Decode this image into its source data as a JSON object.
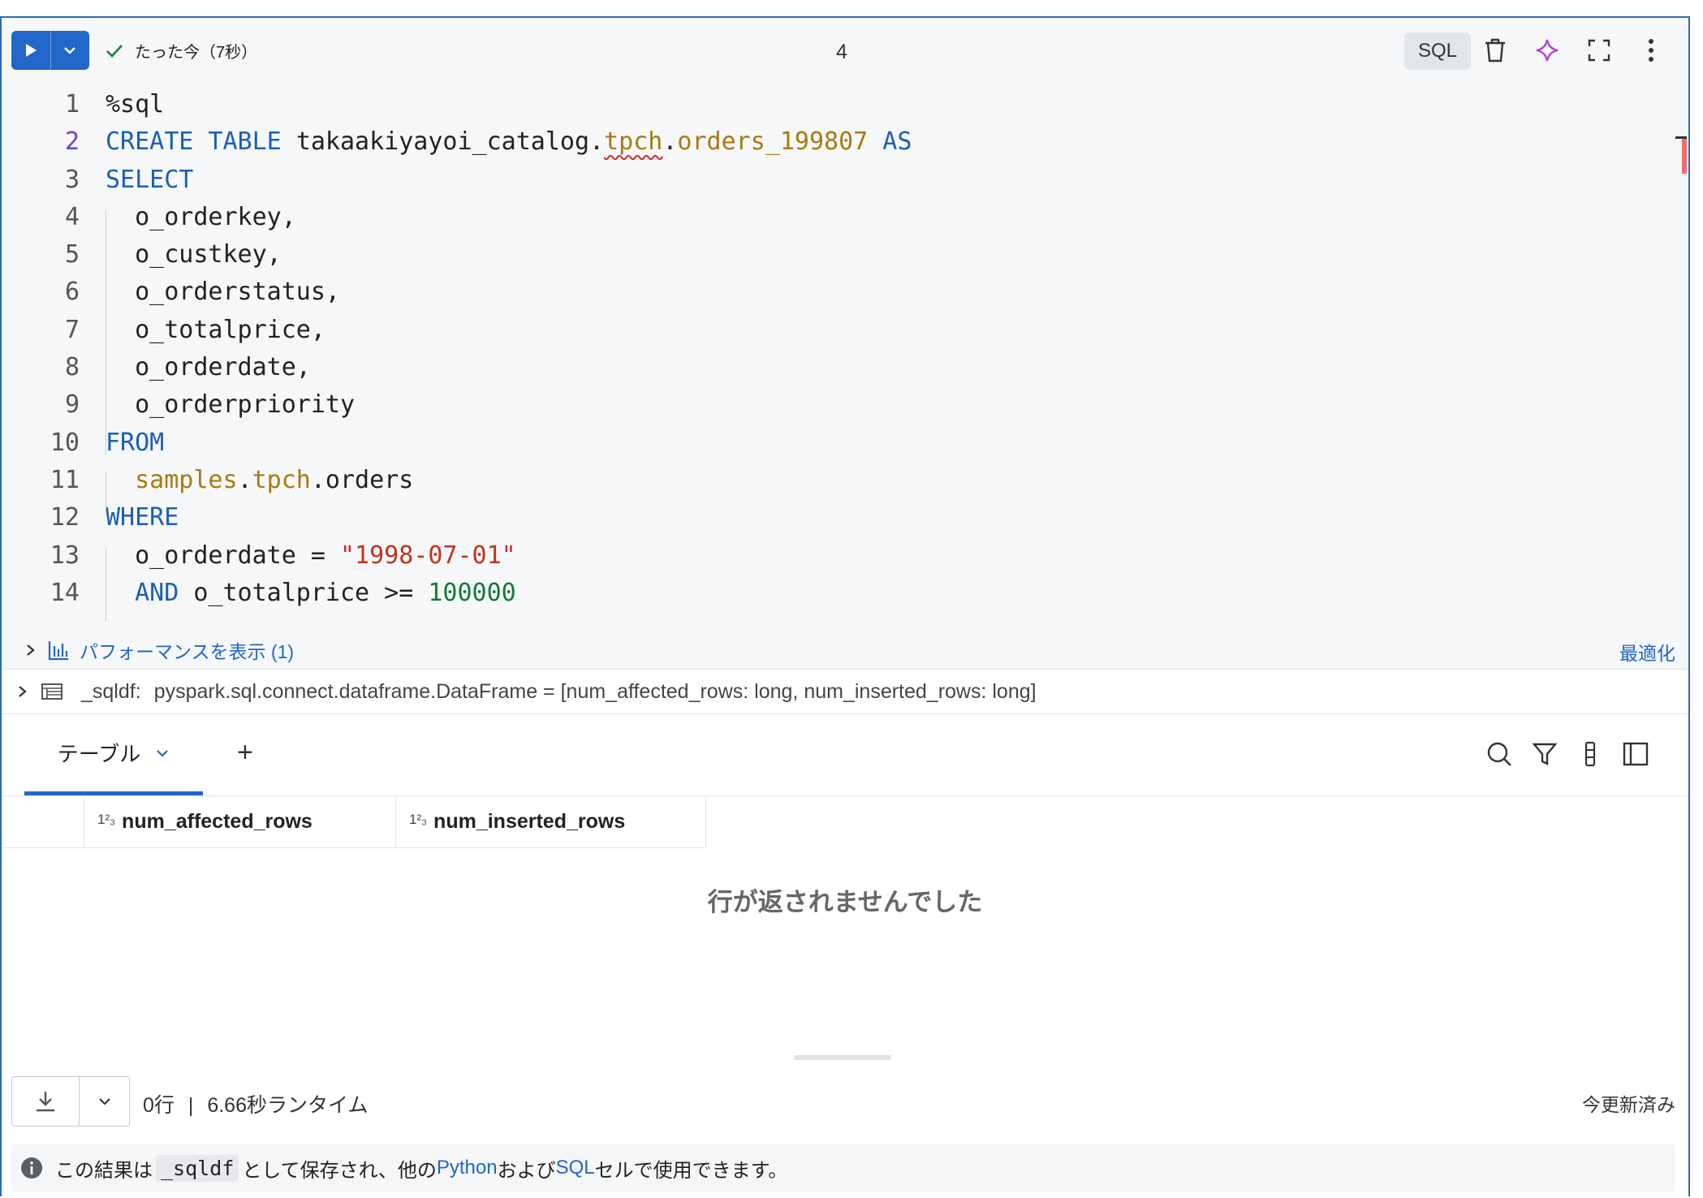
{
  "toolbar": {
    "status_text": "たった今（7秒）",
    "cell_number": "4",
    "language": "SQL"
  },
  "code_lines": [
    {
      "n": "1",
      "segments": [
        [
          "%sql",
          ""
        ]
      ]
    },
    {
      "n": "2",
      "segments": [
        [
          "CREATE TABLE ",
          "kw"
        ],
        [
          "takaakiyayoi_catalog",
          ""
        ],
        [
          ".",
          ""
        ],
        [
          "tpch",
          "tb wavy"
        ],
        [
          ".",
          ""
        ],
        [
          "orders_199807",
          "tb"
        ],
        [
          " AS",
          "kw"
        ]
      ]
    },
    {
      "n": "3",
      "segments": [
        [
          "SELECT",
          "kw"
        ]
      ]
    },
    {
      "n": "4",
      "segments": [
        [
          "  o_orderkey,",
          ""
        ]
      ]
    },
    {
      "n": "5",
      "segments": [
        [
          "  o_custkey,",
          ""
        ]
      ]
    },
    {
      "n": "6",
      "segments": [
        [
          "  o_orderstatus,",
          ""
        ]
      ]
    },
    {
      "n": "7",
      "segments": [
        [
          "  o_totalprice,",
          ""
        ]
      ]
    },
    {
      "n": "8",
      "segments": [
        [
          "  o_orderdate,",
          ""
        ]
      ]
    },
    {
      "n": "9",
      "segments": [
        [
          "  o_orderpriority",
          ""
        ]
      ]
    },
    {
      "n": "10",
      "segments": [
        [
          "FROM",
          "kw"
        ]
      ]
    },
    {
      "n": "11",
      "segments": [
        [
          "  ",
          ""
        ],
        [
          "samples",
          "tb"
        ],
        [
          ".",
          ""
        ],
        [
          "tpch",
          "tb"
        ],
        [
          ".orders",
          ""
        ]
      ]
    },
    {
      "n": "12",
      "segments": [
        [
          "WHERE",
          "kw"
        ]
      ]
    },
    {
      "n": "13",
      "segments": [
        [
          "  o_orderdate = ",
          ""
        ],
        [
          "\"1998-07-01\"",
          "str"
        ]
      ]
    },
    {
      "n": "14",
      "segments": [
        [
          "  ",
          ""
        ],
        [
          "AND",
          "kw"
        ],
        [
          " o_totalprice >= ",
          ""
        ],
        [
          "100000",
          "num"
        ]
      ]
    }
  ],
  "performance": {
    "label": "パフォーマンスを表示 (1)",
    "optimize": "最適化"
  },
  "dataframe": {
    "name": "_sqldf:",
    "type": "pyspark.sql.connect.dataframe.DataFrame = [num_affected_rows: long, num_inserted_rows: long]"
  },
  "results": {
    "tab_label": "テーブル",
    "add_symbol": "+",
    "columns": [
      {
        "name": "num_affected_rows",
        "type_glyph": "1²₃"
      },
      {
        "name": "num_inserted_rows",
        "type_glyph": "1²₃"
      }
    ],
    "empty_message": "行が返されませんでした",
    "row_count": "0行",
    "separator": "|",
    "runtime": "6.66秒ランタイム",
    "updated": "今更新済み"
  },
  "info": {
    "prefix": "この結果は",
    "var": "_sqldf",
    "middle": "として保存され、他の",
    "python": "Python",
    "and": "および",
    "sql": "SQL",
    "suffix": "セルで使用できます。"
  },
  "colors": {
    "accent": "#2266c9",
    "keyword": "#1a5fb4",
    "table": "#a77a10",
    "string": "#c0341d",
    "number": "#127a3a"
  }
}
